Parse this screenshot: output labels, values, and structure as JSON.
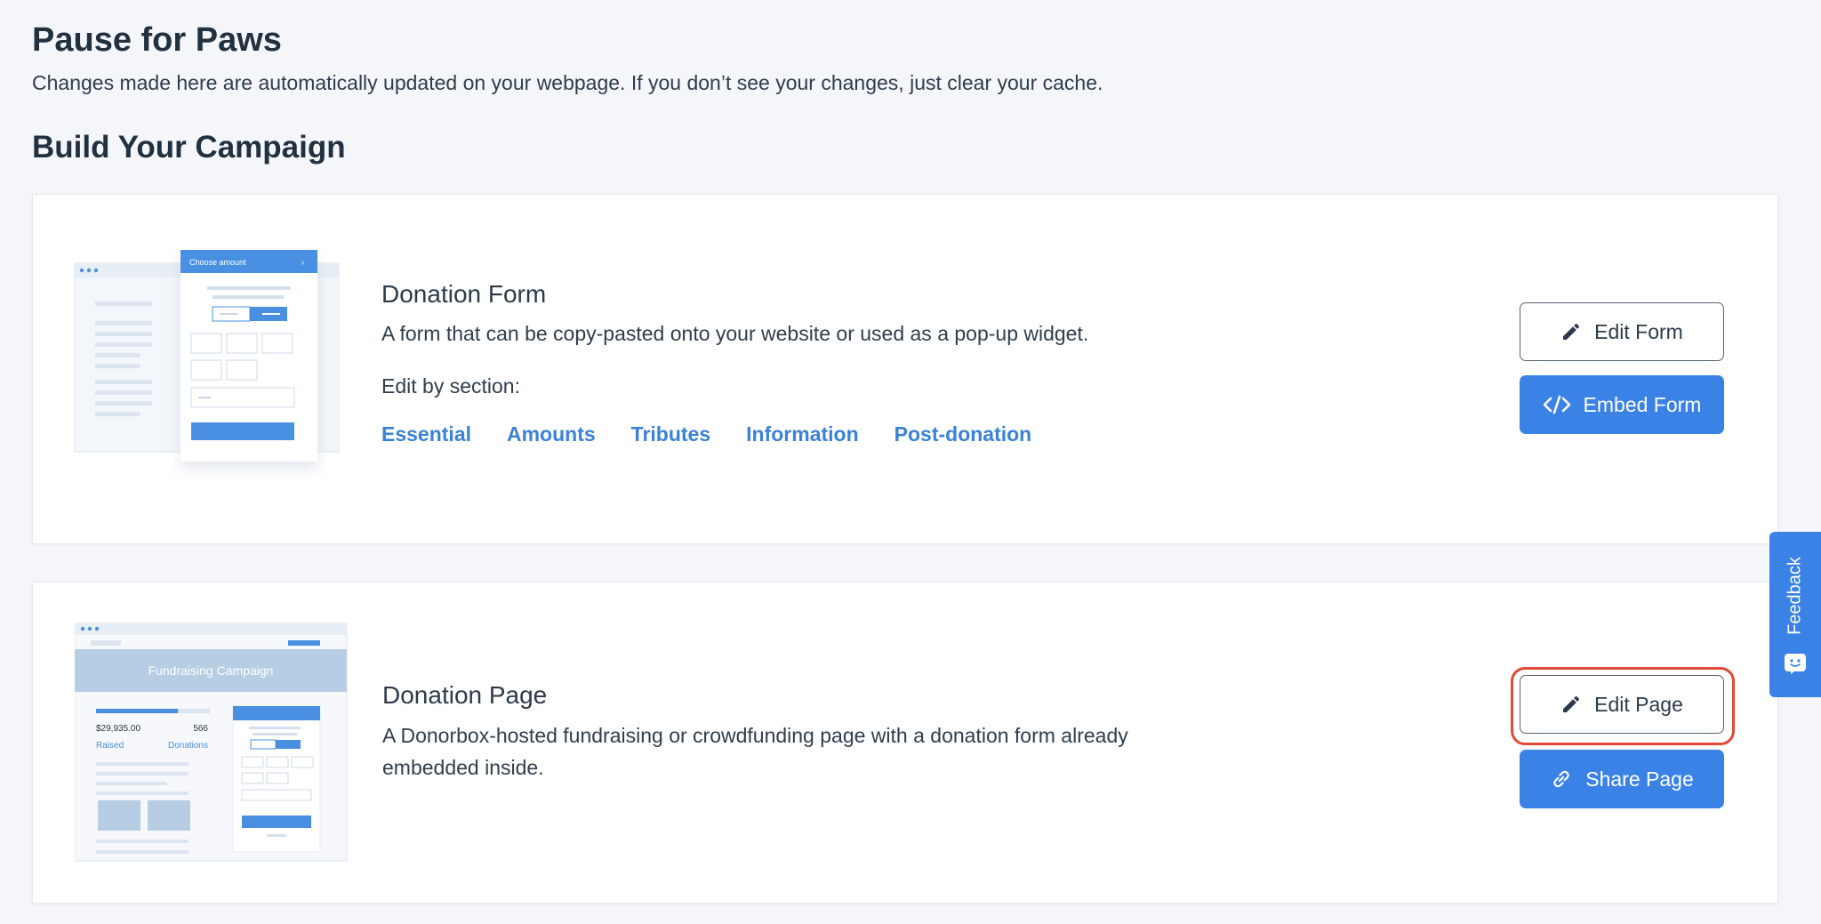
{
  "header": {
    "title": "Pause for Paws",
    "subtitle": "Changes made here are automatically updated on your webpage. If you don’t see your changes, just clear your cache."
  },
  "build": {
    "title": "Build Your Campaign"
  },
  "donation_form": {
    "heading": "Donation Form",
    "description": "A form that can be copy-pasted onto your website or used as a pop-up widget.",
    "edit_by_label": "Edit by section:",
    "sections": [
      "Essential",
      "Amounts",
      "Tributes",
      "Information",
      "Post-donation"
    ],
    "edit_button": "Edit Form",
    "embed_button": "Embed Form",
    "illustration": {
      "header_text": "Choose amount"
    }
  },
  "donation_page": {
    "heading": "Donation Page",
    "description_line1": "A Donorbox-hosted fundraising or crowdfunding page with a donation form already",
    "description_line2": "embedded inside.",
    "edit_button": "Edit Page",
    "share_button": "Share Page",
    "illustration": {
      "banner_text": "Fundraising Campaign",
      "raised_amount": "$29,935.00",
      "donations_count": "566",
      "raised_label": "Raised",
      "donations_label": "Donations",
      "progress": 0.72
    }
  },
  "feedback": {
    "label": "Feedback"
  },
  "colors": {
    "accent": "#3a82e6",
    "link": "#3a82d6",
    "highlight": "#e14a35"
  },
  "icons": {
    "edit": "pencil-icon",
    "embed": "code-icon",
    "share": "link-icon",
    "feedback": "chat-face-icon"
  }
}
